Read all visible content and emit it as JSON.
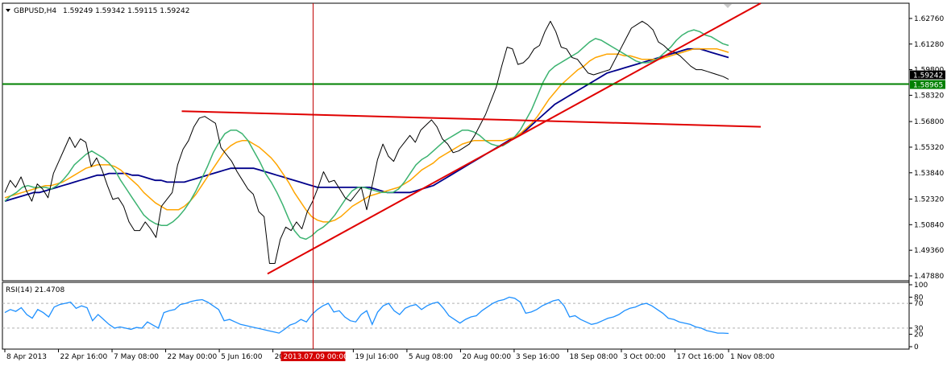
{
  "header": {
    "symbol": "GBPUSD,H4",
    "ohlc": "1.59249 1.59342 1.59115 1.59242"
  },
  "colors": {
    "price": "#000000",
    "ma_fast": "#3cb371",
    "ma_mid": "#ffa500",
    "ma_slow": "#00008b",
    "trend": "#e00000",
    "support": "#008000",
    "rsi": "#1e90ff",
    "cursor_line": "#c00000",
    "cursor_label_bg": "#d40000"
  },
  "chart_data": [
    {
      "type": "line",
      "title": "GBPUSD,H4",
      "ylim": [
        1.476,
        1.6364
      ],
      "y_ticks": [
        "1.62760",
        "1.61280",
        "1.59800",
        "1.58320",
        "1.56800",
        "1.55320",
        "1.53840",
        "1.52320",
        "1.50840",
        "1.49360",
        "1.47880"
      ],
      "y_tick_values": [
        1.6276,
        1.6128,
        1.598,
        1.5832,
        1.568,
        1.5532,
        1.5384,
        1.5232,
        1.5084,
        1.4936,
        1.4788
      ],
      "x_ticks": [
        "8 Apr 2013",
        "22 Apr 16:00",
        "7 May 08:00",
        "22 May 00:00",
        "5 Jun 16:00",
        "20 Jun 08:00",
        "19 Jul 16:00",
        "5 Aug 08:00",
        "20 Aug 00:00",
        "3 Sep 16:00",
        "18 Sep 08:00",
        "3 Oct 00:00",
        "17 Oct 16:00",
        "1 Nov 08:00"
      ],
      "x_tick_index": [
        0,
        10,
        20,
        30,
        40,
        50,
        65,
        75,
        85,
        95,
        105,
        115,
        125,
        135
      ],
      "bars": 135,
      "current_price": "1.59242",
      "current_price_value": 1.59242,
      "support_level": "1.58965",
      "support_level_value": 1.58965,
      "crosshair_label": "2013.07.09 00:00",
      "crosshair_index": 57.5,
      "series": [
        {
          "role": "price",
          "values": [
            1.527,
            1.534,
            1.53,
            1.536,
            1.528,
            1.522,
            1.532,
            1.529,
            1.524,
            1.538,
            1.545,
            1.552,
            1.559,
            1.553,
            1.558,
            1.556,
            1.542,
            1.547,
            1.54,
            1.531,
            1.523,
            1.524,
            1.519,
            1.51,
            1.505,
            1.505,
            1.51,
            1.506,
            1.501,
            1.519,
            1.523,
            1.527,
            1.543,
            1.552,
            1.557,
            1.565,
            1.57,
            1.571,
            1.569,
            1.567,
            1.553,
            1.549,
            1.545,
            1.539,
            1.534,
            1.529,
            1.526,
            1.516,
            1.513,
            1.486,
            1.486,
            1.5,
            1.507,
            1.505,
            1.51,
            1.506,
            1.516,
            1.522,
            1.53,
            1.539,
            1.533,
            1.534,
            1.529,
            1.524,
            1.522,
            1.526,
            1.53,
            1.517,
            1.531,
            1.546,
            1.555,
            1.548,
            1.545,
            1.552,
            1.556,
            1.56,
            1.556,
            1.563,
            1.566,
            1.569,
            1.565,
            1.558,
            1.555,
            1.55,
            1.551,
            1.553,
            1.555,
            1.56,
            1.566,
            1.572,
            1.58,
            1.588,
            1.6,
            1.611,
            1.61,
            1.601,
            1.602,
            1.605,
            1.61,
            1.612,
            1.62,
            1.626,
            1.62,
            1.611,
            1.61,
            1.605,
            1.604,
            1.6,
            1.596,
            1.595,
            1.596,
            1.597,
            1.598,
            1.604,
            1.61,
            1.616,
            1.622,
            1.624,
            1.626,
            1.624,
            1.621,
            1.614,
            1.612,
            1.609,
            1.608,
            1.606,
            1.603,
            1.6,
            1.598,
            1.598,
            1.597,
            1.596,
            1.595,
            1.594,
            1.5924
          ]
        },
        {
          "role": "ma_fast",
          "values": [
            1.522,
            1.525,
            1.527,
            1.53,
            1.531,
            1.53,
            1.53,
            1.53,
            1.529,
            1.531,
            1.534,
            1.538,
            1.543,
            1.546,
            1.549,
            1.551,
            1.549,
            1.547,
            1.544,
            1.54,
            1.534,
            1.529,
            1.524,
            1.519,
            1.514,
            1.511,
            1.509,
            1.508,
            1.508,
            1.51,
            1.513,
            1.517,
            1.522,
            1.528,
            1.535,
            1.542,
            1.55,
            1.556,
            1.561,
            1.563,
            1.563,
            1.561,
            1.557,
            1.551,
            1.545,
            1.538,
            1.533,
            1.527,
            1.52,
            1.512,
            1.505,
            1.501,
            1.5,
            1.502,
            1.505,
            1.507,
            1.51,
            1.514,
            1.519,
            1.524,
            1.528,
            1.53,
            1.53,
            1.529,
            1.528,
            1.527,
            1.527,
            1.527,
            1.529,
            1.533,
            1.538,
            1.543,
            1.546,
            1.548,
            1.551,
            1.554,
            1.557,
            1.559,
            1.561,
            1.563,
            1.563,
            1.562,
            1.56,
            1.557,
            1.555,
            1.554,
            1.554,
            1.556,
            1.559,
            1.563,
            1.569,
            1.575,
            1.583,
            1.591,
            1.597,
            1.6,
            1.602,
            1.604,
            1.606,
            1.608,
            1.611,
            1.614,
            1.616,
            1.615,
            1.613,
            1.611,
            1.609,
            1.607,
            1.605,
            1.603,
            1.602,
            1.602,
            1.603,
            1.605,
            1.608,
            1.611,
            1.615,
            1.618,
            1.62,
            1.621,
            1.62,
            1.618,
            1.617,
            1.615,
            1.613,
            1.612
          ]
        },
        {
          "role": "ma_mid",
          "values": [
            1.524,
            1.525,
            1.526,
            1.527,
            1.528,
            1.529,
            1.53,
            1.531,
            1.531,
            1.532,
            1.533,
            1.535,
            1.537,
            1.539,
            1.541,
            1.542,
            1.543,
            1.543,
            1.543,
            1.542,
            1.54,
            1.537,
            1.534,
            1.531,
            1.527,
            1.524,
            1.521,
            1.519,
            1.517,
            1.517,
            1.517,
            1.519,
            1.522,
            1.526,
            1.531,
            1.536,
            1.541,
            1.546,
            1.551,
            1.554,
            1.556,
            1.557,
            1.557,
            1.555,
            1.553,
            1.55,
            1.547,
            1.543,
            1.538,
            1.533,
            1.527,
            1.522,
            1.517,
            1.513,
            1.511,
            1.51,
            1.51,
            1.511,
            1.513,
            1.516,
            1.519,
            1.521,
            1.523,
            1.525,
            1.526,
            1.527,
            1.528,
            1.529,
            1.53,
            1.532,
            1.534,
            1.537,
            1.54,
            1.542,
            1.544,
            1.547,
            1.549,
            1.551,
            1.553,
            1.555,
            1.556,
            1.557,
            1.557,
            1.557,
            1.557,
            1.557,
            1.557,
            1.558,
            1.559,
            1.561,
            1.564,
            1.567,
            1.571,
            1.576,
            1.581,
            1.585,
            1.589,
            1.592,
            1.595,
            1.598,
            1.6,
            1.603,
            1.605,
            1.606,
            1.607,
            1.607,
            1.607,
            1.606,
            1.606,
            1.605,
            1.604,
            1.604,
            1.604,
            1.604,
            1.605,
            1.606,
            1.607,
            1.608,
            1.609,
            1.61,
            1.61,
            1.61,
            1.61,
            1.61,
            1.609,
            1.608
          ]
        },
        {
          "role": "ma_slow",
          "values": [
            1.522,
            1.523,
            1.524,
            1.525,
            1.526,
            1.527,
            1.527,
            1.528,
            1.529,
            1.53,
            1.531,
            1.532,
            1.533,
            1.534,
            1.535,
            1.536,
            1.537,
            1.537,
            1.538,
            1.538,
            1.538,
            1.538,
            1.537,
            1.537,
            1.536,
            1.535,
            1.534,
            1.534,
            1.533,
            1.533,
            1.533,
            1.533,
            1.534,
            1.535,
            1.536,
            1.537,
            1.538,
            1.539,
            1.54,
            1.541,
            1.541,
            1.541,
            1.541,
            1.541,
            1.54,
            1.539,
            1.538,
            1.537,
            1.536,
            1.535,
            1.534,
            1.533,
            1.532,
            1.531,
            1.53,
            1.53,
            1.53,
            1.53,
            1.53,
            1.53,
            1.53,
            1.53,
            1.53,
            1.53,
            1.529,
            1.528,
            1.527,
            1.527,
            1.527,
            1.527,
            1.527,
            1.528,
            1.529,
            1.53,
            1.531,
            1.533,
            1.535,
            1.537,
            1.539,
            1.541,
            1.543,
            1.545,
            1.547,
            1.549,
            1.551,
            1.553,
            1.555,
            1.557,
            1.559,
            1.561,
            1.563,
            1.566,
            1.569,
            1.572,
            1.575,
            1.578,
            1.58,
            1.582,
            1.584,
            1.586,
            1.588,
            1.59,
            1.592,
            1.594,
            1.596,
            1.597,
            1.598,
            1.599,
            1.6,
            1.601,
            1.602,
            1.603,
            1.604,
            1.605,
            1.606,
            1.607,
            1.608,
            1.609,
            1.61,
            1.61,
            1.61,
            1.609,
            1.608,
            1.607,
            1.606,
            1.605
          ]
        }
      ],
      "trend_lines": [
        {
          "from": [
            49,
            1.48
          ],
          "to": [
            141,
            1.6364
          ]
        },
        {
          "from": [
            33,
            1.574
          ],
          "to": [
            141,
            1.565
          ]
        }
      ]
    },
    {
      "type": "line",
      "title": "RSI(14) 21.4708",
      "ylim": [
        0,
        100
      ],
      "y_ticks": [
        "100",
        "80",
        "70",
        "30",
        "20",
        "0"
      ],
      "y_tick_values": [
        100,
        80,
        70,
        30,
        20,
        0
      ],
      "levels": [
        70,
        30
      ],
      "series": [
        {
          "role": "rsi",
          "values": [
            55,
            60,
            57,
            63,
            52,
            46,
            60,
            55,
            48,
            64,
            68,
            70,
            72,
            62,
            66,
            63,
            42,
            52,
            44,
            36,
            30,
            32,
            30,
            28,
            31,
            30,
            40,
            35,
            30,
            55,
            58,
            60,
            68,
            70,
            73,
            75,
            76,
            72,
            66,
            60,
            42,
            44,
            40,
            36,
            34,
            32,
            30,
            28,
            26,
            24,
            22,
            28,
            35,
            38,
            44,
            40,
            52,
            60,
            66,
            70,
            56,
            58,
            48,
            42,
            40,
            52,
            58,
            36,
            56,
            66,
            70,
            58,
            52,
            62,
            66,
            68,
            60,
            66,
            70,
            72,
            62,
            50,
            44,
            38,
            44,
            48,
            50,
            58,
            64,
            70,
            74,
            76,
            80,
            78,
            72,
            54,
            56,
            60,
            66,
            70,
            74,
            76,
            66,
            48,
            50,
            44,
            40,
            36,
            38,
            42,
            46,
            48,
            52,
            58,
            62,
            64,
            68,
            70,
            66,
            60,
            54,
            46,
            44,
            40,
            38,
            36,
            32,
            30,
            26,
            24,
            22,
            22,
            21.47
          ]
        }
      ]
    }
  ]
}
